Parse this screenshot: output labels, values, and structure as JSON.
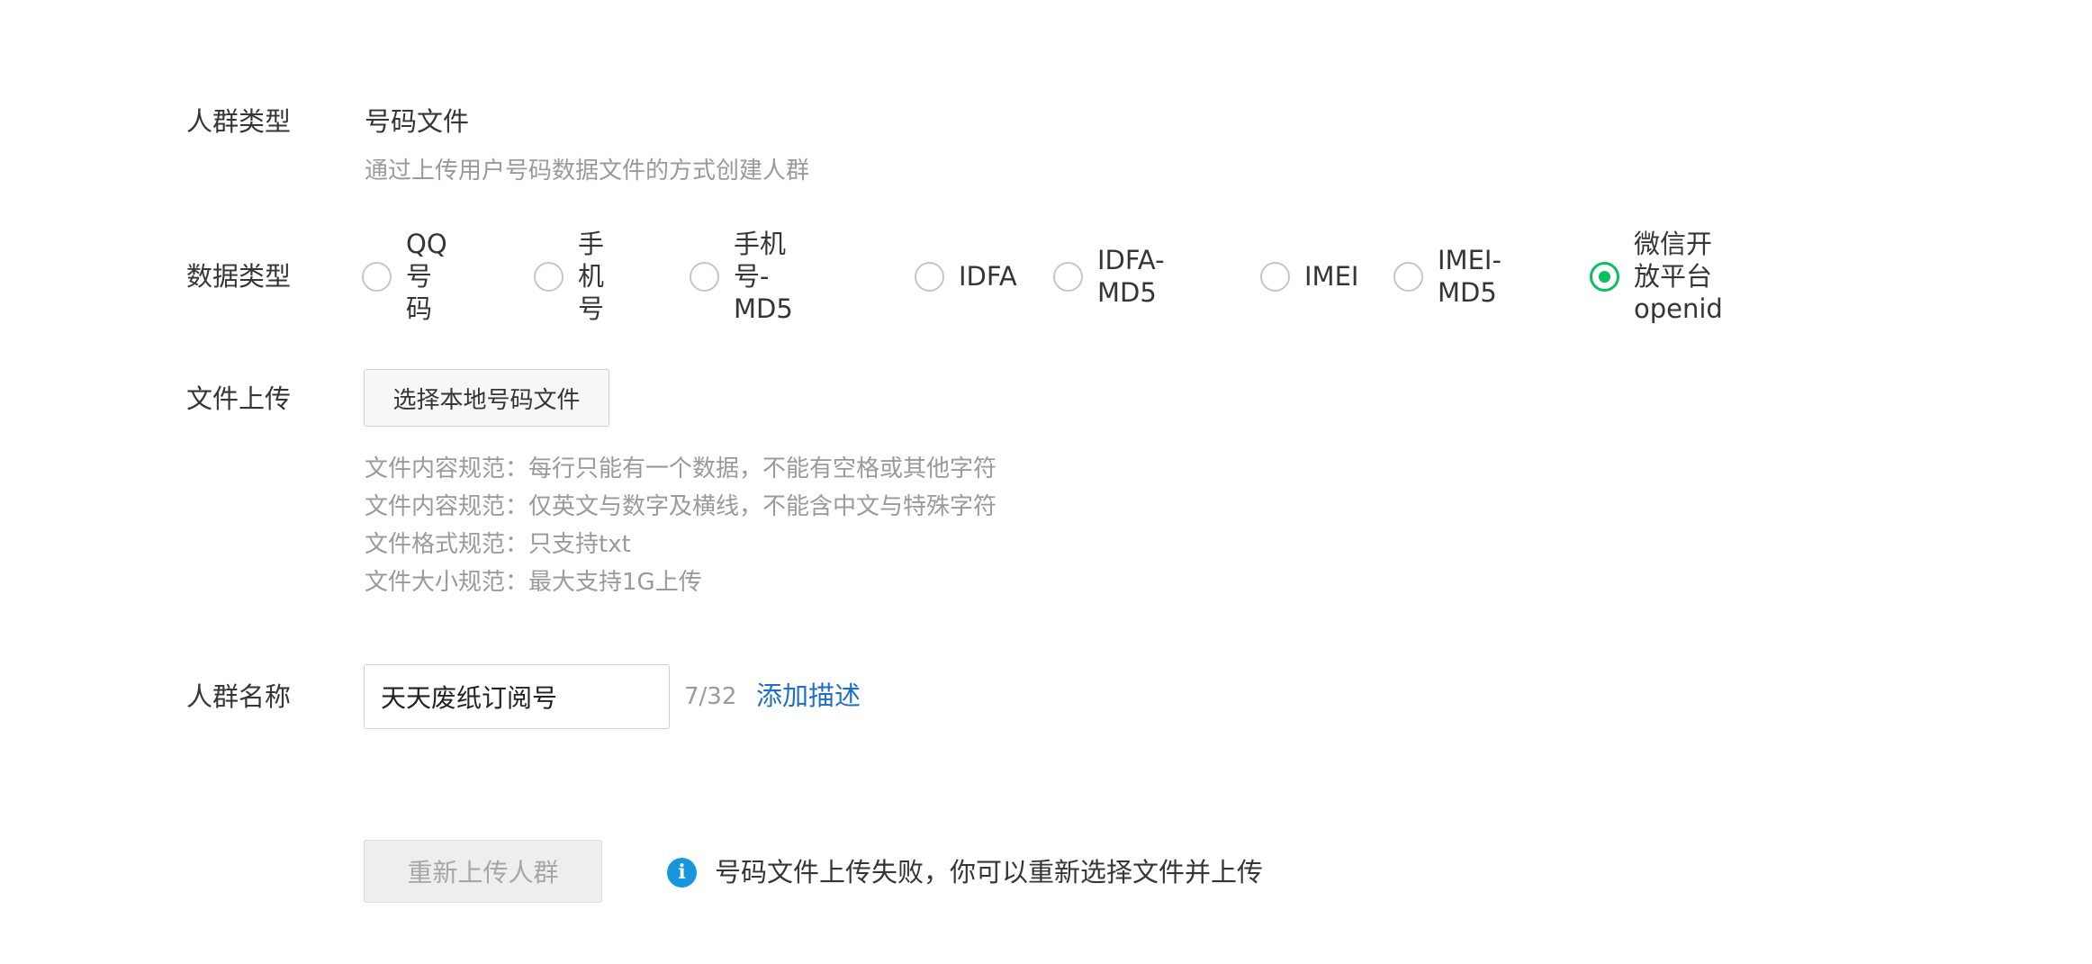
{
  "form": {
    "crowd_type": {
      "label": "人群类型",
      "value": "号码文件",
      "description": "通过上传用户号码数据文件的方式创建人群"
    },
    "data_type": {
      "label": "数据类型",
      "options": [
        {
          "label": "QQ号码",
          "checked": false
        },
        {
          "label": "手机号",
          "checked": false
        },
        {
          "label": "手机号-MD5",
          "checked": false
        },
        {
          "label": "IDFA",
          "checked": false
        },
        {
          "label": "IDFA-MD5",
          "checked": false
        },
        {
          "label": "IMEI",
          "checked": false
        },
        {
          "label": "IMEI-MD5",
          "checked": false
        },
        {
          "label": "微信开放平台openid",
          "checked": true
        }
      ],
      "checked_color": "#07c160"
    },
    "file_upload": {
      "label": "文件上传",
      "button_label": "选择本地号码文件",
      "specs": [
        "文件内容规范：每行只能有一个数据，不能有空格或其他字符",
        "文件内容规范：仅英文与数字及横线，不能含中文与特殊字符",
        "文件格式规范：只支持txt",
        "文件大小规范：最大支持1G上传"
      ]
    },
    "crowd_name": {
      "label": "人群名称",
      "value": "天天废纸订阅号",
      "counter": "7/32",
      "add_description_link": "添加描述",
      "link_color": "#1f6fc8"
    }
  },
  "actions": {
    "reupload_button": "重新上传人群",
    "reupload_disabled": true,
    "info_icon": "info-icon",
    "info_icon_glyph": "i",
    "info_color": "#1896dd",
    "tip": "号码文件上传失败，你可以重新选择文件并上传"
  }
}
